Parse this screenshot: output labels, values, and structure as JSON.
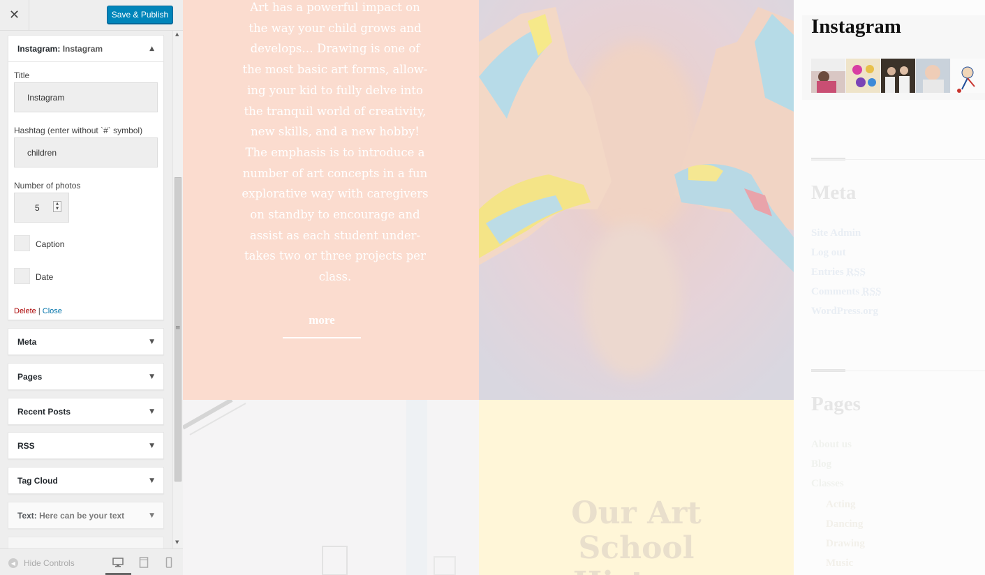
{
  "header": {
    "close_glyph": "✕",
    "publish_label": "Save & Publish"
  },
  "instagram_widget": {
    "title_prefix": "Instagram:",
    "title_suffix": " Instagram",
    "fields": {
      "title_label": "Title",
      "title_value": "Instagram",
      "hashtag_label": "Hashtag (enter without `#` symbol)",
      "hashtag_value": "children",
      "photos_label": "Number of photos",
      "photos_value": "5",
      "caption_label": "Caption",
      "date_label": "Date"
    },
    "delete_label": "Delete",
    "separator": "|",
    "close_label": "Close"
  },
  "widgets": [
    {
      "label": "Meta"
    },
    {
      "label": "Pages"
    },
    {
      "label": "Recent Posts"
    },
    {
      "label": "RSS"
    },
    {
      "label": "Tag Cloud"
    },
    {
      "label": "Text:",
      "sub": " Here can be your text"
    }
  ],
  "footer": {
    "hide_controls_label": "Hide Controls"
  },
  "preview": {
    "description": "Art has a powerful impact on\nthe way your child grows and\ndevelops… Drawing is one of\nthe most basic art forms, allow-\ning your kid to fully delve into\nthe tranquil world of creativity,\nnew skills, and a new hobby!\nThe emphasis is to introduce a\nnumber of art concepts in a fun\nexplorative way with caregivers\non standby to encourage and\nassist as each student under-\ntakes two or three projects per\nclass.",
    "more_label": "more",
    "school_title": "Our Art\nSchool\nHistory",
    "instagram_heading": "Instagram",
    "meta_heading": "Meta",
    "meta_links": [
      {
        "text": "Site Admin"
      },
      {
        "text": "Log out"
      },
      {
        "text": "Entries ",
        "abbr": "RSS"
      },
      {
        "text": "Comments ",
        "abbr": "RSS"
      },
      {
        "text": "WordPress.org"
      }
    ],
    "pages_heading": "Pages",
    "page_links": [
      "About us",
      "Blog",
      "Classes"
    ],
    "class_links": [
      "Acting",
      "Dancing",
      "Drawing",
      "Music"
    ]
  },
  "colors": {
    "publish_blue": "#0085ba",
    "delete_red": "#aa0000",
    "link_blue": "#0073aa",
    "peach": "#fbdccf"
  }
}
